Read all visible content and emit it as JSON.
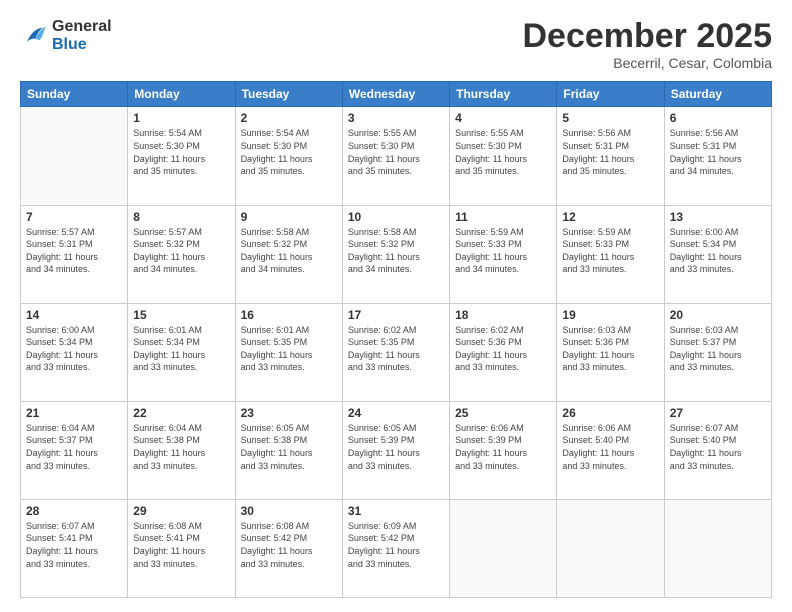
{
  "logo": {
    "general": "General",
    "blue": "Blue"
  },
  "title": "December 2025",
  "location": "Becerril, Cesar, Colombia",
  "weekdays": [
    "Sunday",
    "Monday",
    "Tuesday",
    "Wednesday",
    "Thursday",
    "Friday",
    "Saturday"
  ],
  "weeks": [
    [
      {
        "day": "",
        "info": ""
      },
      {
        "day": "1",
        "info": "Sunrise: 5:54 AM\nSunset: 5:30 PM\nDaylight: 11 hours\nand 35 minutes."
      },
      {
        "day": "2",
        "info": "Sunrise: 5:54 AM\nSunset: 5:30 PM\nDaylight: 11 hours\nand 35 minutes."
      },
      {
        "day": "3",
        "info": "Sunrise: 5:55 AM\nSunset: 5:30 PM\nDaylight: 11 hours\nand 35 minutes."
      },
      {
        "day": "4",
        "info": "Sunrise: 5:55 AM\nSunset: 5:30 PM\nDaylight: 11 hours\nand 35 minutes."
      },
      {
        "day": "5",
        "info": "Sunrise: 5:56 AM\nSunset: 5:31 PM\nDaylight: 11 hours\nand 35 minutes."
      },
      {
        "day": "6",
        "info": "Sunrise: 5:56 AM\nSunset: 5:31 PM\nDaylight: 11 hours\nand 34 minutes."
      }
    ],
    [
      {
        "day": "7",
        "info": "Sunrise: 5:57 AM\nSunset: 5:31 PM\nDaylight: 11 hours\nand 34 minutes."
      },
      {
        "day": "8",
        "info": "Sunrise: 5:57 AM\nSunset: 5:32 PM\nDaylight: 11 hours\nand 34 minutes."
      },
      {
        "day": "9",
        "info": "Sunrise: 5:58 AM\nSunset: 5:32 PM\nDaylight: 11 hours\nand 34 minutes."
      },
      {
        "day": "10",
        "info": "Sunrise: 5:58 AM\nSunset: 5:32 PM\nDaylight: 11 hours\nand 34 minutes."
      },
      {
        "day": "11",
        "info": "Sunrise: 5:59 AM\nSunset: 5:33 PM\nDaylight: 11 hours\nand 34 minutes."
      },
      {
        "day": "12",
        "info": "Sunrise: 5:59 AM\nSunset: 5:33 PM\nDaylight: 11 hours\nand 33 minutes."
      },
      {
        "day": "13",
        "info": "Sunrise: 6:00 AM\nSunset: 5:34 PM\nDaylight: 11 hours\nand 33 minutes."
      }
    ],
    [
      {
        "day": "14",
        "info": "Sunrise: 6:00 AM\nSunset: 5:34 PM\nDaylight: 11 hours\nand 33 minutes."
      },
      {
        "day": "15",
        "info": "Sunrise: 6:01 AM\nSunset: 5:34 PM\nDaylight: 11 hours\nand 33 minutes."
      },
      {
        "day": "16",
        "info": "Sunrise: 6:01 AM\nSunset: 5:35 PM\nDaylight: 11 hours\nand 33 minutes."
      },
      {
        "day": "17",
        "info": "Sunrise: 6:02 AM\nSunset: 5:35 PM\nDaylight: 11 hours\nand 33 minutes."
      },
      {
        "day": "18",
        "info": "Sunrise: 6:02 AM\nSunset: 5:36 PM\nDaylight: 11 hours\nand 33 minutes."
      },
      {
        "day": "19",
        "info": "Sunrise: 6:03 AM\nSunset: 5:36 PM\nDaylight: 11 hours\nand 33 minutes."
      },
      {
        "day": "20",
        "info": "Sunrise: 6:03 AM\nSunset: 5:37 PM\nDaylight: 11 hours\nand 33 minutes."
      }
    ],
    [
      {
        "day": "21",
        "info": "Sunrise: 6:04 AM\nSunset: 5:37 PM\nDaylight: 11 hours\nand 33 minutes."
      },
      {
        "day": "22",
        "info": "Sunrise: 6:04 AM\nSunset: 5:38 PM\nDaylight: 11 hours\nand 33 minutes."
      },
      {
        "day": "23",
        "info": "Sunrise: 6:05 AM\nSunset: 5:38 PM\nDaylight: 11 hours\nand 33 minutes."
      },
      {
        "day": "24",
        "info": "Sunrise: 6:05 AM\nSunset: 5:39 PM\nDaylight: 11 hours\nand 33 minutes."
      },
      {
        "day": "25",
        "info": "Sunrise: 6:06 AM\nSunset: 5:39 PM\nDaylight: 11 hours\nand 33 minutes."
      },
      {
        "day": "26",
        "info": "Sunrise: 6:06 AM\nSunset: 5:40 PM\nDaylight: 11 hours\nand 33 minutes."
      },
      {
        "day": "27",
        "info": "Sunrise: 6:07 AM\nSunset: 5:40 PM\nDaylight: 11 hours\nand 33 minutes."
      }
    ],
    [
      {
        "day": "28",
        "info": "Sunrise: 6:07 AM\nSunset: 5:41 PM\nDaylight: 11 hours\nand 33 minutes."
      },
      {
        "day": "29",
        "info": "Sunrise: 6:08 AM\nSunset: 5:41 PM\nDaylight: 11 hours\nand 33 minutes."
      },
      {
        "day": "30",
        "info": "Sunrise: 6:08 AM\nSunset: 5:42 PM\nDaylight: 11 hours\nand 33 minutes."
      },
      {
        "day": "31",
        "info": "Sunrise: 6:09 AM\nSunset: 5:42 PM\nDaylight: 11 hours\nand 33 minutes."
      },
      {
        "day": "",
        "info": ""
      },
      {
        "day": "",
        "info": ""
      },
      {
        "day": "",
        "info": ""
      }
    ]
  ]
}
